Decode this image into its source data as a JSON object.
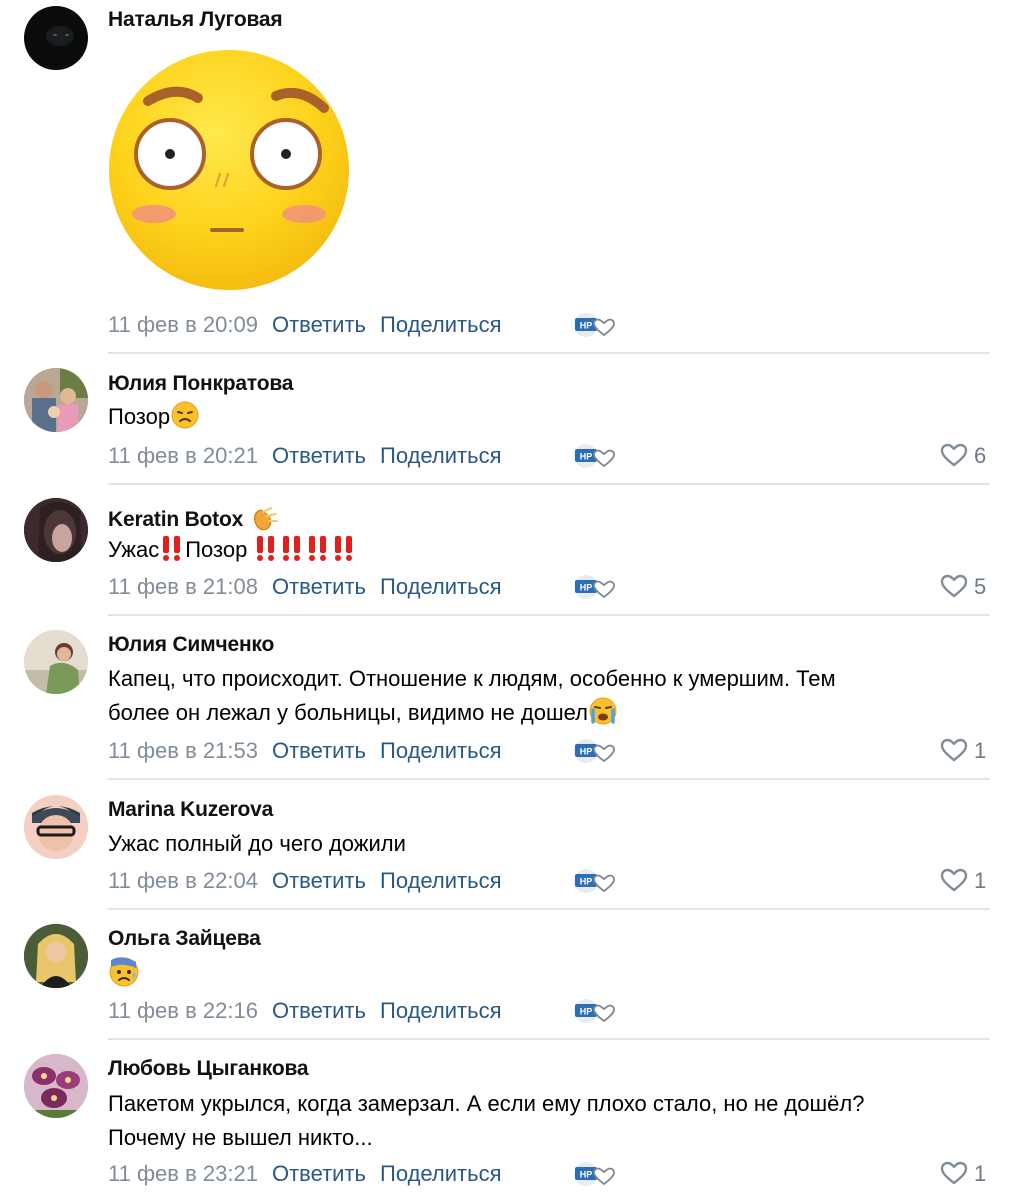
{
  "actions": {
    "reply": "Ответить",
    "share": "Поделиться"
  },
  "comments": [
    {
      "author": "Наталья Луговая",
      "text": "",
      "time": "11 фев в 20:09",
      "likes": ""
    },
    {
      "author": "Юлия Понкратова",
      "text": "Позор",
      "time": "11 фев в 20:21",
      "likes": "6"
    },
    {
      "author": "Keratin Botox",
      "text_a": "Ужас",
      "text_b": "Позор",
      "time": "11 фев в 21:08",
      "likes": "5"
    },
    {
      "author": "Юлия Симченко",
      "text": "Капец, что происходит. Отношение к людям, особенно к умершим. Тем\nболее он лежал у больницы, видимо не дошел",
      "time": "11 фев в 21:53",
      "likes": "1"
    },
    {
      "author": "Marina Kuzerova",
      "text": "Ужас полный до чего дожили",
      "time": "11 фев в 22:04",
      "likes": "1"
    },
    {
      "author": "Ольга Зайцева",
      "text": "",
      "time": "11 фев в 22:16",
      "likes": ""
    },
    {
      "author": "Любовь Цыганкова",
      "text": "Пакетом укрылся, когда замерзал. А если ему плохо стало, но не дошёл?\nПочему не вышел никто...",
      "time": "11 фев в 23:21",
      "likes": "1"
    }
  ],
  "colors": {
    "link": "#2a5885",
    "meta": "#818c99",
    "divider": "#e3e5e8",
    "like_icon": "#6f7985"
  }
}
